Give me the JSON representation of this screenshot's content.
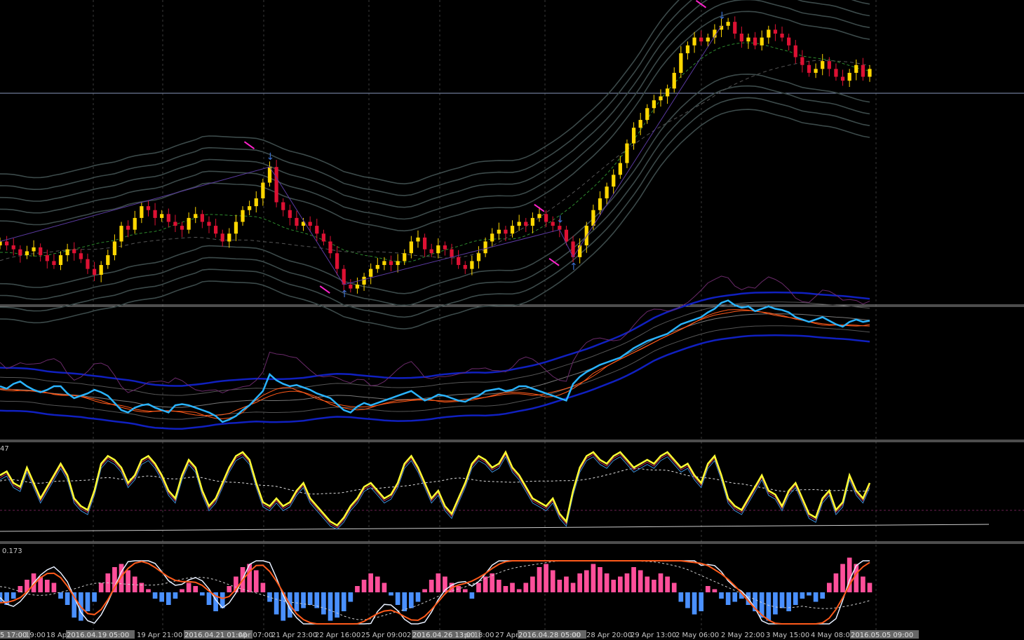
{
  "colors": {
    "background": "#000000",
    "grid": "#3a3a3a",
    "candle_up": "#ffd700",
    "candle_down": "#dd1133",
    "band": "#3c4a4a",
    "band_mid": "#2e8b2e",
    "zigzag": "#5a3aa0",
    "marker": "#3a70d0",
    "arrow": "#ff22cc",
    "price_line": "#8899bb",
    "cyan": "#2ab4ff",
    "orange": "#ff5a1a",
    "blue": "#1020c0",
    "purple": "#6a2a6a",
    "yellow": "#ffff33",
    "histo_pos": "#ff4f9a",
    "histo_neg": "#4a90ff",
    "white_line": "#e8f0ff",
    "date_bg": "#666666"
  },
  "chart_data": [
    {
      "type": "line",
      "panel": "price",
      "xlabel": "",
      "ylabel": "",
      "grid": true,
      "close": [
        0.62,
        0.6,
        0.58,
        0.55,
        0.57,
        0.59,
        0.55,
        0.52,
        0.5,
        0.55,
        0.58,
        0.56,
        0.53,
        0.48,
        0.45,
        0.5,
        0.55,
        0.62,
        0.7,
        0.68,
        0.74,
        0.8,
        0.78,
        0.74,
        0.76,
        0.72,
        0.7,
        0.68,
        0.74,
        0.76,
        0.72,
        0.7,
        0.66,
        0.62,
        0.66,
        0.72,
        0.78,
        0.8,
        0.84,
        0.92,
        1.0,
        0.82,
        0.78,
        0.74,
        0.7,
        0.72,
        0.7,
        0.66,
        0.62,
        0.56,
        0.48,
        0.4,
        0.38,
        0.4,
        0.44,
        0.48,
        0.5,
        0.52,
        0.5,
        0.52,
        0.56,
        0.62,
        0.64,
        0.58,
        0.56,
        0.6,
        0.58,
        0.54,
        0.5,
        0.48,
        0.52,
        0.56,
        0.62,
        0.66,
        0.68,
        0.66,
        0.7,
        0.72,
        0.7,
        0.74,
        0.76,
        0.72,
        0.7,
        0.68,
        0.62,
        0.54,
        0.6,
        0.7,
        0.78,
        0.84,
        0.9,
        0.96,
        1.02,
        1.12,
        1.2,
        1.24,
        1.3,
        1.34,
        1.36,
        1.4,
        1.48,
        1.58,
        1.62,
        1.66,
        1.64,
        1.66,
        1.7,
        1.72,
        1.74,
        1.68,
        1.64,
        1.66,
        1.62,
        1.66,
        1.7,
        1.68,
        1.66,
        1.62,
        1.56,
        1.52,
        1.48,
        1.5,
        1.54,
        1.5,
        1.46,
        1.44,
        1.48,
        1.52,
        1.46,
        1.5
      ],
      "markers": [
        {
          "label": "top",
          "at": 40
        },
        {
          "label": "bottom",
          "at": 51
        },
        {
          "label": "top",
          "at": 83
        },
        {
          "label": "bottom",
          "at": 85
        },
        {
          "label": "top",
          "at": 107
        }
      ]
    },
    {
      "type": "line",
      "panel": "indicator_bands",
      "series": [
        {
          "values": [
            0.3,
            0.32,
            0.28,
            0.26,
            0.3,
            0.33,
            0.35,
            0.33,
            0.3,
            0.3,
            0.36,
            0.4,
            0.38,
            0.36,
            0.33,
            0.35,
            0.38,
            0.44,
            0.5,
            0.52,
            0.48,
            0.46,
            0.45,
            0.48,
            0.5,
            0.52,
            0.46,
            0.45,
            0.46,
            0.48,
            0.5,
            0.52,
            0.55,
            0.6,
            0.58,
            0.55,
            0.5,
            0.46,
            0.4,
            0.34,
            0.2,
            0.25,
            0.28,
            0.3,
            0.29,
            0.31,
            0.33,
            0.36,
            0.38,
            0.4,
            0.45,
            0.5,
            0.52,
            0.47,
            0.44,
            0.46,
            0.44,
            0.42,
            0.4,
            0.38,
            0.36,
            0.34,
            0.38,
            0.42,
            0.4,
            0.37,
            0.38,
            0.4,
            0.42,
            0.43,
            0.4,
            0.38,
            0.34,
            0.33,
            0.32,
            0.34,
            0.33,
            0.3,
            0.3,
            0.32,
            0.34,
            0.36,
            0.38,
            0.4,
            0.42,
            0.28,
            0.22,
            0.18,
            0.15,
            0.12,
            0.1,
            0.08,
            0.06,
            0.02,
            -0.02,
            -0.05,
            -0.08,
            -0.1,
            -0.12,
            -0.14,
            -0.18,
            -0.22,
            -0.24,
            -0.26,
            -0.28,
            -0.32,
            -0.35,
            -0.4,
            -0.42,
            -0.38,
            -0.36,
            -0.37,
            -0.33,
            -0.35,
            -0.37,
            -0.35,
            -0.34,
            -0.32,
            -0.28,
            -0.26,
            -0.24,
            -0.26,
            -0.28,
            -0.25,
            -0.22,
            -0.2,
            -0.24,
            -0.26,
            -0.24,
            -0.25
          ]
        }
      ]
    },
    {
      "type": "line",
      "panel": "oscillator",
      "label": "47",
      "series": [
        {
          "values": [
            0.7,
            0.75,
            0.6,
            0.55,
            0.8,
            0.6,
            0.4,
            0.55,
            0.7,
            0.85,
            0.7,
            0.4,
            0.3,
            0.25,
            0.5,
            0.85,
            0.95,
            0.9,
            0.8,
            0.6,
            0.7,
            0.9,
            0.95,
            0.85,
            0.7,
            0.5,
            0.4,
            0.7,
            0.9,
            0.8,
            0.5,
            0.3,
            0.4,
            0.6,
            0.8,
            0.95,
            1.0,
            0.9,
            0.6,
            0.35,
            0.3,
            0.4,
            0.3,
            0.35,
            0.5,
            0.6,
            0.4,
            0.3,
            0.2,
            0.1,
            0.05,
            0.15,
            0.3,
            0.4,
            0.55,
            0.6,
            0.5,
            0.4,
            0.45,
            0.6,
            0.85,
            0.95,
            0.8,
            0.6,
            0.4,
            0.5,
            0.3,
            0.2,
            0.4,
            0.6,
            0.85,
            0.95,
            0.9,
            0.8,
            0.85,
            1.0,
            0.8,
            0.7,
            0.55,
            0.4,
            0.35,
            0.3,
            0.4,
            0.2,
            0.1,
            0.5,
            0.8,
            0.95,
            1.0,
            0.9,
            0.85,
            0.95,
            1.0,
            0.9,
            0.8,
            0.85,
            0.9,
            0.85,
            0.95,
            1.0,
            0.9,
            0.8,
            0.85,
            0.7,
            0.6,
            0.85,
            0.95,
            0.7,
            0.4,
            0.3,
            0.25,
            0.4,
            0.55,
            0.7,
            0.5,
            0.45,
            0.3,
            0.5,
            0.6,
            0.4,
            0.2,
            0.15,
            0.4,
            0.5,
            0.25,
            0.35,
            0.7,
            0.5,
            0.4,
            0.6
          ]
        }
      ]
    },
    {
      "type": "bar",
      "panel": "macd",
      "label": "0.173",
      "values": [
        -0.3,
        -0.4,
        -0.2,
        0.2,
        0.4,
        0.6,
        0.5,
        0.4,
        0.3,
        -0.2,
        -0.4,
        -0.8,
        -0.9,
        -0.6,
        -0.3,
        0.3,
        0.6,
        0.8,
        0.9,
        0.7,
        0.5,
        0.3,
        0.1,
        -0.2,
        -0.3,
        -0.4,
        -0.2,
        0.1,
        0.3,
        0.2,
        -0.1,
        -0.4,
        -0.6,
        -0.5,
        0.2,
        0.5,
        0.8,
        0.9,
        0.7,
        0.3,
        -0.3,
        -0.7,
        -0.9,
        -0.8,
        -0.6,
        -0.5,
        -0.4,
        -0.5,
        -0.7,
        -0.9,
        -0.8,
        -0.6,
        -0.3,
        0.2,
        0.4,
        0.6,
        0.5,
        0.3,
        -0.1,
        -0.4,
        -0.6,
        -0.5,
        -0.3,
        0.1,
        0.4,
        0.6,
        0.5,
        0.3,
        0.2,
        0.1,
        -0.2,
        0.3,
        0.5,
        0.6,
        0.4,
        0.2,
        0.3,
        0.1,
        0.3,
        0.5,
        0.8,
        0.9,
        0.7,
        0.4,
        0.5,
        0.3,
        0.6,
        0.7,
        0.9,
        0.8,
        0.6,
        0.4,
        0.5,
        0.6,
        0.8,
        0.7,
        0.5,
        0.4,
        0.6,
        0.5,
        0.3,
        -0.3,
        -0.5,
        -0.7,
        -0.6,
        0.2,
        0.1,
        -0.2,
        -0.4,
        -0.3,
        -0.2,
        -0.4,
        -0.6,
        -0.8,
        -0.9,
        -0.7,
        -0.5,
        -0.6,
        -0.4,
        -0.2,
        -0.1,
        -0.3,
        -0.2,
        0.3,
        0.6,
        0.9,
        1.1,
        0.9,
        0.5,
        0.3
      ]
    }
  ],
  "x_axis": {
    "labels": [
      "5 17:00",
      "19:00",
      "18 Ap",
      "2016.04.19 05:00",
      "19 Apr 21:00",
      "2016.04.21 01:00",
      "Apr 07:00",
      "21 Apr 23:00",
      "22 Apr 16:00",
      "25 Apr 09:00",
      "2",
      "2016.04.26 13:00",
      "pr 18:00",
      "27 Apr",
      "2016.04.28 05:00",
      "00",
      "28 Apr 20:00",
      "29 Apr 13:00",
      "2 May 06:00",
      "2 May 22:00",
      "3 May 15:00",
      "4 May 08:00",
      "2016.05.05 09:00"
    ],
    "highlighted": [
      0,
      3,
      5,
      11,
      14,
      22
    ]
  }
}
